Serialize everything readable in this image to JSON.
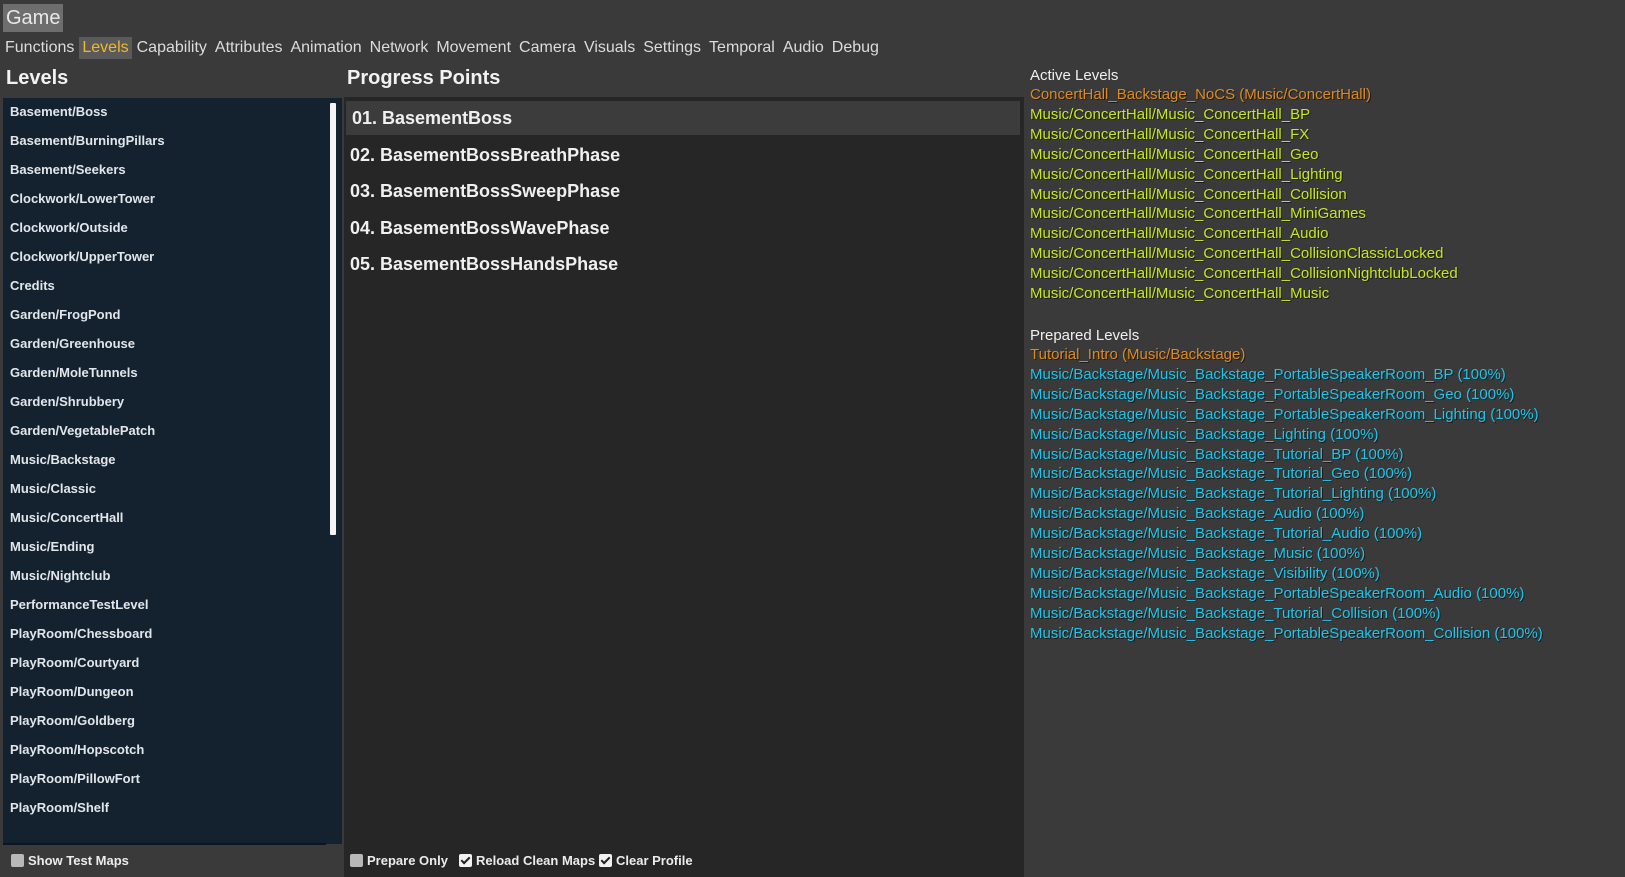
{
  "window": {
    "title": "Game"
  },
  "tabs": [
    {
      "label": "Functions"
    },
    {
      "label": "Levels"
    },
    {
      "label": "Capability"
    },
    {
      "label": "Attributes"
    },
    {
      "label": "Animation"
    },
    {
      "label": "Network"
    },
    {
      "label": "Movement"
    },
    {
      "label": "Camera"
    },
    {
      "label": "Visuals"
    },
    {
      "label": "Settings"
    },
    {
      "label": "Temporal"
    },
    {
      "label": "Audio"
    },
    {
      "label": "Debug"
    }
  ],
  "active_tab": "Levels",
  "levels": {
    "title": "Levels",
    "items": [
      "Basement/Boss",
      "Basement/BurningPillars",
      "Basement/Seekers",
      "Clockwork/LowerTower",
      "Clockwork/Outside",
      "Clockwork/UpperTower",
      "Credits",
      "Garden/FrogPond",
      "Garden/Greenhouse",
      "Garden/MoleTunnels",
      "Garden/Shrubbery",
      "Garden/VegetablePatch",
      "Music/Backstage",
      "Music/Classic",
      "Music/ConcertHall",
      "Music/Ending",
      "Music/Nightclub",
      "PerformanceTestLevel",
      "PlayRoom/Chessboard",
      "PlayRoom/Courtyard",
      "PlayRoom/Dungeon",
      "PlayRoom/Goldberg",
      "PlayRoom/Hopscotch",
      "PlayRoom/PillowFort",
      "PlayRoom/Shelf"
    ],
    "show_test_maps": {
      "label": "Show Test Maps",
      "checked": false
    }
  },
  "progress": {
    "title": "Progress Points",
    "items": [
      "01. BasementBoss",
      "02. BasementBossBreathPhase",
      "03. BasementBossSweepPhase",
      "04. BasementBossWavePhase",
      "05. BasementBossHandsPhase"
    ],
    "selected_index": 0,
    "options": [
      {
        "label": "Prepare Only",
        "checked": false
      },
      {
        "label": "Reload Clean Maps",
        "checked": true
      },
      {
        "label": "Clear Profile",
        "checked": true
      }
    ]
  },
  "active_levels": {
    "title": "Active Levels",
    "primary": "ConcertHall_Backstage_NoCS (Music/ConcertHall)",
    "items": [
      "Music/ConcertHall/Music_ConcertHall_BP",
      "Music/ConcertHall/Music_ConcertHall_FX",
      "Music/ConcertHall/Music_ConcertHall_Geo",
      "Music/ConcertHall/Music_ConcertHall_Lighting",
      "Music/ConcertHall/Music_ConcertHall_Collision",
      "Music/ConcertHall/Music_ConcertHall_MiniGames",
      "Music/ConcertHall/Music_ConcertHall_Audio",
      "Music/ConcertHall/Music_ConcertHall_CollisionClassicLocked",
      "Music/ConcertHall/Music_ConcertHall_CollisionNightclubLocked",
      "Music/ConcertHall/Music_ConcertHall_Music"
    ]
  },
  "prepared_levels": {
    "title": "Prepared Levels",
    "primary": "Tutorial_Intro (Music/Backstage)",
    "items": [
      "Music/Backstage/Music_Backstage_PortableSpeakerRoom_BP (100%)",
      "Music/Backstage/Music_Backstage_PortableSpeakerRoom_Geo (100%)",
      "Music/Backstage/Music_Backstage_PortableSpeakerRoom_Lighting (100%)",
      "Music/Backstage/Music_Backstage_Lighting (100%)",
      "Music/Backstage/Music_Backstage_Tutorial_BP (100%)",
      "Music/Backstage/Music_Backstage_Tutorial_Geo (100%)",
      "Music/Backstage/Music_Backstage_Tutorial_Lighting (100%)",
      "Music/Backstage/Music_Backstage_Audio (100%)",
      "Music/Backstage/Music_Backstage_Tutorial_Audio (100%)",
      "Music/Backstage/Music_Backstage_Music (100%)",
      "Music/Backstage/Music_Backstage_Visibility (100%)",
      "Music/Backstage/Music_Backstage_PortableSpeakerRoom_Audio (100%)",
      "Music/Backstage/Music_Backstage_Tutorial_Collision (100%)",
      "Music/Backstage/Music_Backstage_PortableSpeakerRoom_Collision (100%)"
    ]
  },
  "colors": {
    "accent": "#f2b829",
    "primary_level": "#e08a1e",
    "active_level": "#c8e81c",
    "prepared_level": "#1ec6ec",
    "list_bg": "#142230",
    "panel_bg": "#262626"
  }
}
